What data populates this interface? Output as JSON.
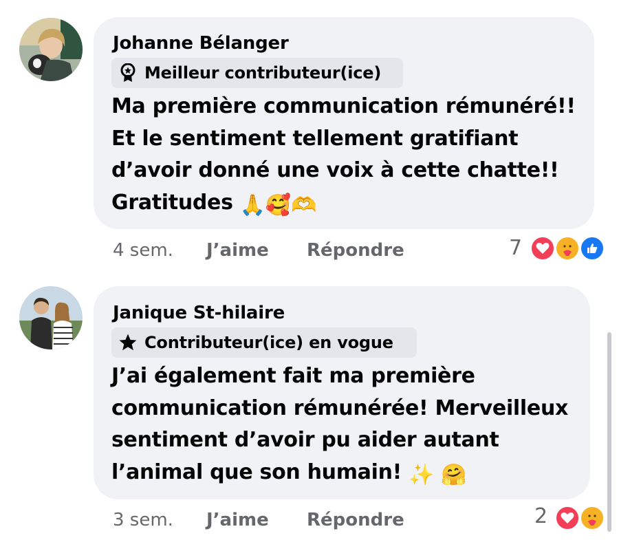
{
  "comments": [
    {
      "author": "Johanne Bélanger",
      "badge": "Meilleur contributeur(ice)",
      "badge_icon": "award-ribbon-icon",
      "lines": [
        "Ma première communication rémunéré!!",
        "Et le sentiment tellement gratifiant",
        "d’avoir donné une voix à cette chatte!!",
        "Gratitudes"
      ],
      "emojis": [
        "🙏",
        "🥰",
        "🫶"
      ],
      "time": "4 sem.",
      "like_label": "J’aime",
      "reply_label": "Répondre",
      "reaction_count": "7",
      "reactions": [
        "love-reaction-icon",
        "care-reaction-icon",
        "like-reaction-icon"
      ]
    },
    {
      "author": "Janique St-hilaire",
      "badge": "Contributeur(ice) en vogue",
      "badge_icon": "star-icon",
      "lines": [
        "J’ai également fait ma première",
        "communication rémunérée! Merveilleux",
        "sentiment d’avoir pu aider autant",
        "l’animal que son humain!"
      ],
      "emojis": [
        "✨",
        "🤗"
      ],
      "time": "3 sem.",
      "like_label": "J’aime",
      "reply_label": "Répondre",
      "reaction_count": "2",
      "reactions": [
        "love-reaction-icon",
        "care-reaction-icon"
      ]
    }
  ],
  "colors": {
    "bubble": "#f0f2f5",
    "badge": "#e4e6eb",
    "meta": "#65676b",
    "love": "#f33e58",
    "like": "#1877f2",
    "care": "#f7b125"
  }
}
